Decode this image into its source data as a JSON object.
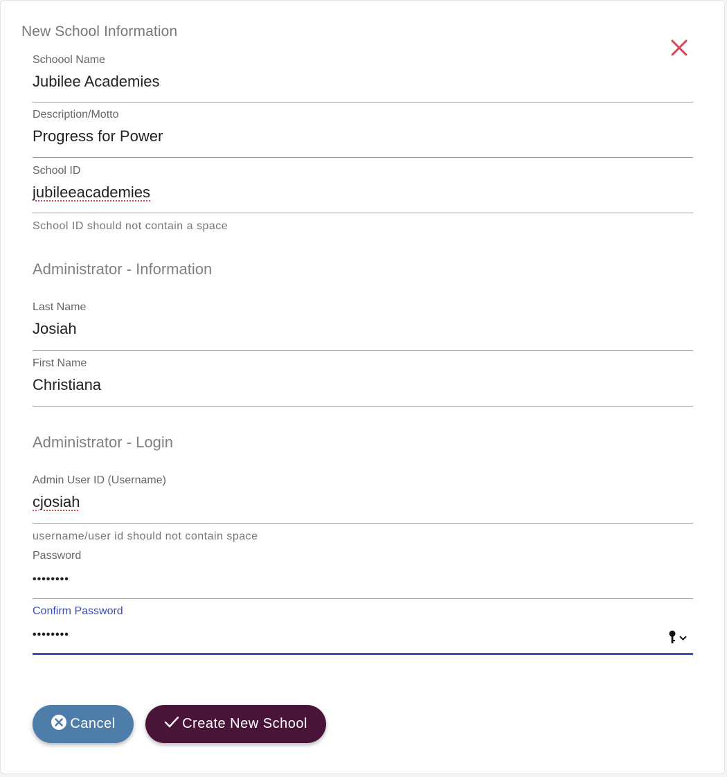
{
  "dialog": {
    "title": "New School Information"
  },
  "fields": {
    "school_name": {
      "label": "Schoool Name",
      "value": "Jubilee Academies"
    },
    "description": {
      "label": "Description/Motto",
      "value": "Progress for Power"
    },
    "school_id": {
      "label": "School ID",
      "value": "jubileeacademies",
      "hint": "School ID should not contain a space"
    },
    "last_name": {
      "label": "Last Name",
      "value": "Josiah"
    },
    "first_name": {
      "label": "First Name",
      "value": "Christiana"
    },
    "admin_user_id": {
      "label": "Admin User ID (Username)",
      "value": "cjosiah",
      "hint": "username/user id should not contain space"
    },
    "password": {
      "label": "Password",
      "value": "••••••••"
    },
    "confirm_password": {
      "label": "Confirm Password",
      "value": "••••••••"
    }
  },
  "sections": {
    "admin_info": "Administrator - Information",
    "admin_login": "Administrator - Login"
  },
  "buttons": {
    "cancel": "Cancel",
    "create": "Create New School"
  },
  "icons": {
    "close": "close-icon",
    "cancel": "cancel-circle-icon",
    "create": "check-icon",
    "password_manager": "key-icon"
  },
  "colors": {
    "close_icon": "#e0405a",
    "focus": "#3a4fb8",
    "cancel_button": "#4f7da9",
    "create_button": "#4a1438"
  }
}
